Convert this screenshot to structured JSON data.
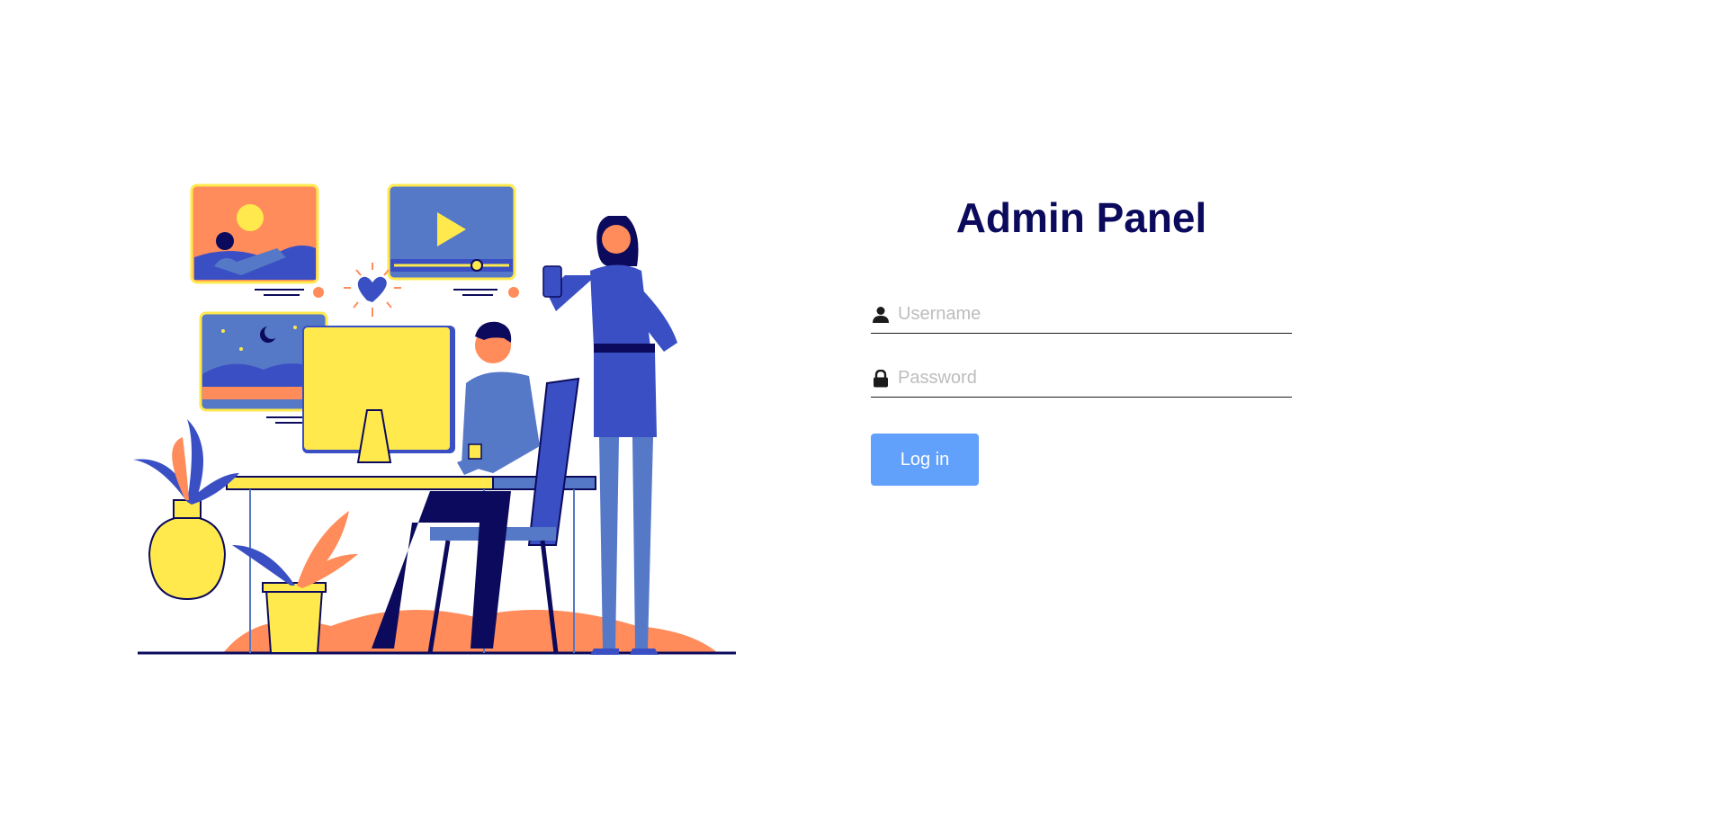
{
  "login": {
    "title": "Admin Panel",
    "username_placeholder": "Username",
    "username_value": "",
    "password_placeholder": "Password",
    "password_value": "",
    "login_button_label": "Log in",
    "button_color": "#62a1fb",
    "title_color": "#0b0a5c"
  },
  "illustration": {
    "icons": [
      "user-icon",
      "lock-icon"
    ],
    "palette": [
      "#3a4fc3",
      "#ffe94d",
      "#ff8c5a",
      "#0b0a5c",
      "#5578c7"
    ]
  }
}
